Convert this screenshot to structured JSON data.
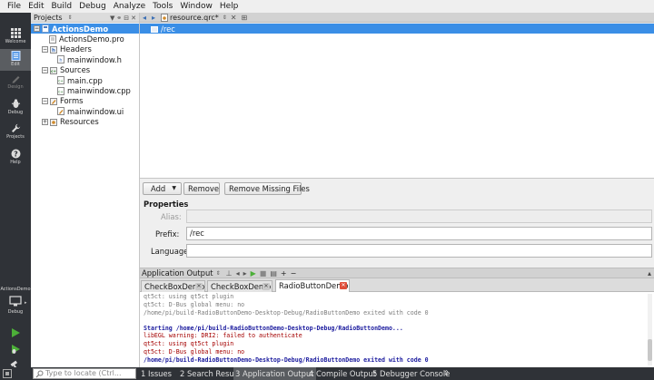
{
  "menubar": {
    "items": [
      "File",
      "Edit",
      "Build",
      "Debug",
      "Analyze",
      "Tools",
      "Window",
      "Help"
    ]
  },
  "modes": {
    "items": [
      {
        "label": "Welcome",
        "icon": "grid-icon"
      },
      {
        "label": "Edit",
        "icon": "document-icon",
        "active": true
      },
      {
        "label": "Design",
        "icon": "pen-icon",
        "disabled": true
      },
      {
        "label": "Debug",
        "icon": "bug-icon"
      },
      {
        "label": "Projects",
        "icon": "wrench-icon"
      },
      {
        "label": "Help",
        "icon": "question-icon"
      }
    ],
    "target_project": "ActionsDemo",
    "target_mode": "Debug"
  },
  "project_panel": {
    "selector": "Projects",
    "tree": [
      {
        "label": "ActionsDemo",
        "level": 0,
        "toggle": "-",
        "icon": "project",
        "selected": true
      },
      {
        "label": "ActionsDemo.pro",
        "level": 1,
        "icon": "profile"
      },
      {
        "label": "Headers",
        "level": 1,
        "toggle": "-",
        "icon": "folder-h"
      },
      {
        "label": "mainwindow.h",
        "level": 2,
        "icon": "header"
      },
      {
        "label": "Sources",
        "level": 1,
        "toggle": "-",
        "icon": "folder-cpp"
      },
      {
        "label": "main.cpp",
        "level": 2,
        "icon": "source"
      },
      {
        "label": "mainwindow.cpp",
        "level": 2,
        "icon": "source"
      },
      {
        "label": "Forms",
        "level": 1,
        "toggle": "-",
        "icon": "folder-ui"
      },
      {
        "label": "mainwindow.ui",
        "level": 2,
        "icon": "form"
      },
      {
        "label": "Resources",
        "level": 1,
        "toggle": "+",
        "icon": "folder-res"
      }
    ]
  },
  "editor": {
    "tab_name": "resource.qrc*",
    "resource_tree": {
      "selected_prefix": "/rec"
    },
    "buttons": {
      "add": "Add",
      "remove": "Remove",
      "remove_missing": "Remove Missing Files"
    },
    "properties": {
      "title": "Properties",
      "alias_label": "Alias:",
      "alias_value": "",
      "prefix_label": "Prefix:",
      "prefix_value": "/rec",
      "language_label": "Language:",
      "language_value": ""
    }
  },
  "output": {
    "title": "Application Output",
    "tabs": [
      {
        "label": "CheckBoxDemo",
        "active": false
      },
      {
        "label": "CheckBoxDemo",
        "active": false
      },
      {
        "label": "RadioButtonDemo",
        "active": true
      }
    ],
    "lines": [
      {
        "text": "qt5ct: using qt5ct plugin",
        "style": "gray"
      },
      {
        "text": "qt5ct: D-Bus global menu: no",
        "style": "gray"
      },
      {
        "text": "/home/pi/build-RadioButtonDemo-Desktop-Debug/RadioButtonDemo exited with code 0",
        "style": "gray"
      },
      {
        "text": "",
        "style": "gray"
      },
      {
        "text": "Starting /home/pi/build-RadioButtonDemo-Desktop-Debug/RadioButtonDemo...",
        "style": "blue"
      },
      {
        "text": "libEGL warning: DRI2: failed to authenticate",
        "style": "red"
      },
      {
        "text": "qt5ct: using qt5ct plugin",
        "style": "red"
      },
      {
        "text": "qt5ct: D-Bus global menu: no",
        "style": "red"
      },
      {
        "text": "/home/pi/build-RadioButtonDemo-Desktop-Debug/RadioButtonDemo exited with code 0",
        "style": "blue"
      }
    ]
  },
  "statusbar": {
    "locate_placeholder": "Type to locate (Ctrl...",
    "tabs": [
      {
        "label": "1 Issues"
      },
      {
        "label": "2 Search Results"
      },
      {
        "label": "3 Application Output",
        "active": true
      },
      {
        "label": "4 Compile Output"
      },
      {
        "label": "5 Debugger Console"
      }
    ]
  },
  "colors": {
    "selection": "#3a8ee6",
    "sidebar": "#2f3237",
    "run_green": "#4caf38",
    "close_red": "#e04e3a"
  }
}
